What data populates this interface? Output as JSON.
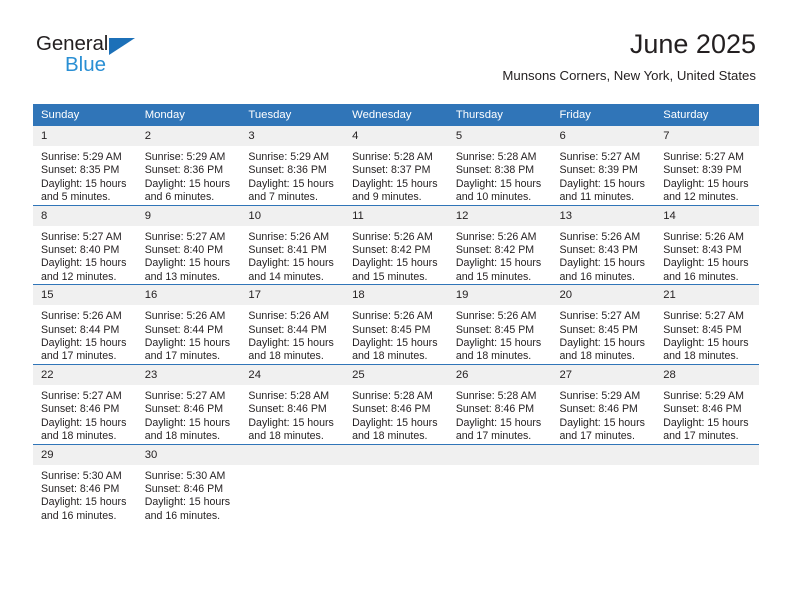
{
  "brand": {
    "name_primary": "General",
    "name_secondary": "Blue",
    "triangle_color": "#1c70b8",
    "secondary_color": "#2a8fd4"
  },
  "header": {
    "month_title": "June 2025",
    "location": "Munsons Corners, New York, United States"
  },
  "theme": {
    "header_blue": "#3075b8",
    "daynum_gray": "#f0f0f0",
    "text": "#231f20"
  },
  "weekday_headers": [
    "Sunday",
    "Monday",
    "Tuesday",
    "Wednesday",
    "Thursday",
    "Friday",
    "Saturday"
  ],
  "weeks": [
    [
      {
        "day": "1",
        "sunrise": "Sunrise: 5:29 AM",
        "sunset": "Sunset: 8:35 PM",
        "daylight": "Daylight: 15 hours and 5 minutes."
      },
      {
        "day": "2",
        "sunrise": "Sunrise: 5:29 AM",
        "sunset": "Sunset: 8:36 PM",
        "daylight": "Daylight: 15 hours and 6 minutes."
      },
      {
        "day": "3",
        "sunrise": "Sunrise: 5:29 AM",
        "sunset": "Sunset: 8:36 PM",
        "daylight": "Daylight: 15 hours and 7 minutes."
      },
      {
        "day": "4",
        "sunrise": "Sunrise: 5:28 AM",
        "sunset": "Sunset: 8:37 PM",
        "daylight": "Daylight: 15 hours and 9 minutes."
      },
      {
        "day": "5",
        "sunrise": "Sunrise: 5:28 AM",
        "sunset": "Sunset: 8:38 PM",
        "daylight": "Daylight: 15 hours and 10 minutes."
      },
      {
        "day": "6",
        "sunrise": "Sunrise: 5:27 AM",
        "sunset": "Sunset: 8:39 PM",
        "daylight": "Daylight: 15 hours and 11 minutes."
      },
      {
        "day": "7",
        "sunrise": "Sunrise: 5:27 AM",
        "sunset": "Sunset: 8:39 PM",
        "daylight": "Daylight: 15 hours and 12 minutes."
      }
    ],
    [
      {
        "day": "8",
        "sunrise": "Sunrise: 5:27 AM",
        "sunset": "Sunset: 8:40 PM",
        "daylight": "Daylight: 15 hours and 12 minutes."
      },
      {
        "day": "9",
        "sunrise": "Sunrise: 5:27 AM",
        "sunset": "Sunset: 8:40 PM",
        "daylight": "Daylight: 15 hours and 13 minutes."
      },
      {
        "day": "10",
        "sunrise": "Sunrise: 5:26 AM",
        "sunset": "Sunset: 8:41 PM",
        "daylight": "Daylight: 15 hours and 14 minutes."
      },
      {
        "day": "11",
        "sunrise": "Sunrise: 5:26 AM",
        "sunset": "Sunset: 8:42 PM",
        "daylight": "Daylight: 15 hours and 15 minutes."
      },
      {
        "day": "12",
        "sunrise": "Sunrise: 5:26 AM",
        "sunset": "Sunset: 8:42 PM",
        "daylight": "Daylight: 15 hours and 15 minutes."
      },
      {
        "day": "13",
        "sunrise": "Sunrise: 5:26 AM",
        "sunset": "Sunset: 8:43 PM",
        "daylight": "Daylight: 15 hours and 16 minutes."
      },
      {
        "day": "14",
        "sunrise": "Sunrise: 5:26 AM",
        "sunset": "Sunset: 8:43 PM",
        "daylight": "Daylight: 15 hours and 16 minutes."
      }
    ],
    [
      {
        "day": "15",
        "sunrise": "Sunrise: 5:26 AM",
        "sunset": "Sunset: 8:44 PM",
        "daylight": "Daylight: 15 hours and 17 minutes."
      },
      {
        "day": "16",
        "sunrise": "Sunrise: 5:26 AM",
        "sunset": "Sunset: 8:44 PM",
        "daylight": "Daylight: 15 hours and 17 minutes."
      },
      {
        "day": "17",
        "sunrise": "Sunrise: 5:26 AM",
        "sunset": "Sunset: 8:44 PM",
        "daylight": "Daylight: 15 hours and 18 minutes."
      },
      {
        "day": "18",
        "sunrise": "Sunrise: 5:26 AM",
        "sunset": "Sunset: 8:45 PM",
        "daylight": "Daylight: 15 hours and 18 minutes."
      },
      {
        "day": "19",
        "sunrise": "Sunrise: 5:26 AM",
        "sunset": "Sunset: 8:45 PM",
        "daylight": "Daylight: 15 hours and 18 minutes."
      },
      {
        "day": "20",
        "sunrise": "Sunrise: 5:27 AM",
        "sunset": "Sunset: 8:45 PM",
        "daylight": "Daylight: 15 hours and 18 minutes."
      },
      {
        "day": "21",
        "sunrise": "Sunrise: 5:27 AM",
        "sunset": "Sunset: 8:45 PM",
        "daylight": "Daylight: 15 hours and 18 minutes."
      }
    ],
    [
      {
        "day": "22",
        "sunrise": "Sunrise: 5:27 AM",
        "sunset": "Sunset: 8:46 PM",
        "daylight": "Daylight: 15 hours and 18 minutes."
      },
      {
        "day": "23",
        "sunrise": "Sunrise: 5:27 AM",
        "sunset": "Sunset: 8:46 PM",
        "daylight": "Daylight: 15 hours and 18 minutes."
      },
      {
        "day": "24",
        "sunrise": "Sunrise: 5:28 AM",
        "sunset": "Sunset: 8:46 PM",
        "daylight": "Daylight: 15 hours and 18 minutes."
      },
      {
        "day": "25",
        "sunrise": "Sunrise: 5:28 AM",
        "sunset": "Sunset: 8:46 PM",
        "daylight": "Daylight: 15 hours and 18 minutes."
      },
      {
        "day": "26",
        "sunrise": "Sunrise: 5:28 AM",
        "sunset": "Sunset: 8:46 PM",
        "daylight": "Daylight: 15 hours and 17 minutes."
      },
      {
        "day": "27",
        "sunrise": "Sunrise: 5:29 AM",
        "sunset": "Sunset: 8:46 PM",
        "daylight": "Daylight: 15 hours and 17 minutes."
      },
      {
        "day": "28",
        "sunrise": "Sunrise: 5:29 AM",
        "sunset": "Sunset: 8:46 PM",
        "daylight": "Daylight: 15 hours and 17 minutes."
      }
    ],
    [
      {
        "day": "29",
        "sunrise": "Sunrise: 5:30 AM",
        "sunset": "Sunset: 8:46 PM",
        "daylight": "Daylight: 15 hours and 16 minutes."
      },
      {
        "day": "30",
        "sunrise": "Sunrise: 5:30 AM",
        "sunset": "Sunset: 8:46 PM",
        "daylight": "Daylight: 15 hours and 16 minutes."
      },
      {
        "day": "",
        "sunrise": "",
        "sunset": "",
        "daylight": ""
      },
      {
        "day": "",
        "sunrise": "",
        "sunset": "",
        "daylight": ""
      },
      {
        "day": "",
        "sunrise": "",
        "sunset": "",
        "daylight": ""
      },
      {
        "day": "",
        "sunrise": "",
        "sunset": "",
        "daylight": ""
      },
      {
        "day": "",
        "sunrise": "",
        "sunset": "",
        "daylight": ""
      }
    ]
  ]
}
